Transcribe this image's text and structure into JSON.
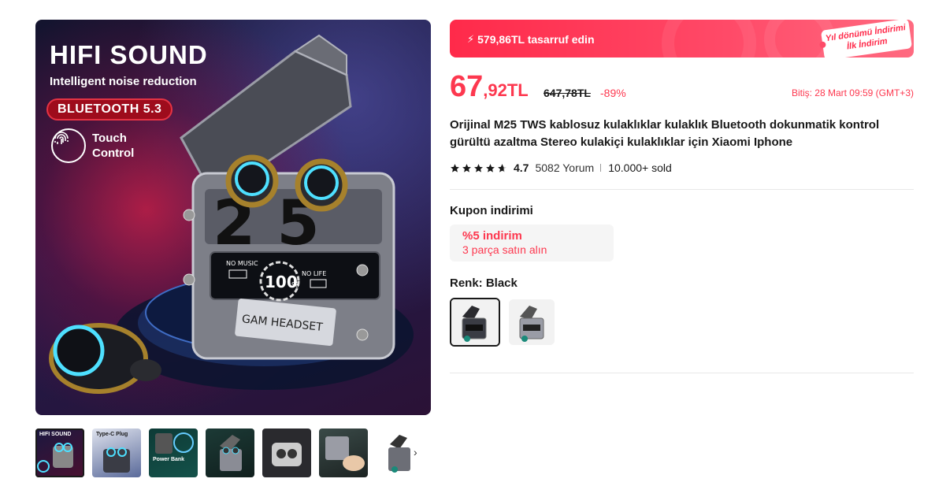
{
  "gallery": {
    "hero": {
      "title": "HIFI SOUND",
      "subtitle": "Intelligent noise reduction",
      "badge": "BLUETOOTH 5.3",
      "touch_label": "Touch\nControl",
      "case_digits": "25",
      "screen_percent": "100",
      "screen_left": "NO MUSIC",
      "screen_right": "NO LIFE",
      "case_label": "GAM HEADSET"
    },
    "thumbnails": [
      {
        "name": "hero",
        "caption": "HIFI SOUND"
      },
      {
        "name": "features",
        "caption": "Type-C Plug"
      },
      {
        "name": "power-bank",
        "caption": "Power Bank"
      },
      {
        "name": "case-open",
        "caption": ""
      },
      {
        "name": "open-case",
        "caption": ""
      },
      {
        "name": "in-hand",
        "caption": ""
      },
      {
        "name": "plain",
        "caption": ""
      }
    ]
  },
  "promo": {
    "savings_text": "579,86TL tasarruf edin",
    "tag_line1": "Yıl dönümü İndirimi",
    "tag_line2": "İlk İndirim"
  },
  "price": {
    "integer": "67",
    "decimal": ",92TL",
    "original": "647,78TL",
    "discount": "-89%",
    "end_text": "Bitiş: 28 Mart 09:59 (GMT+3)"
  },
  "product": {
    "title": "Orijinal M25 TWS kablosuz kulaklıklar kulaklık Bluetooth dokunmatik kontrol gürültü azaltma Stereo kulakiçi kulaklıklar için Xiaomi Iphone"
  },
  "rating": {
    "value": "4.7",
    "stars": 4.7,
    "reviews": "5082 Yorum",
    "sold": "10.000+ sold"
  },
  "coupon": {
    "title": "Kupon indirimi",
    "discount": "%5 indirim",
    "condition": "3 parça satın alın"
  },
  "color": {
    "title": "Renk: Black",
    "options": [
      "Black",
      "Silver"
    ],
    "selected": "Black"
  },
  "colors": {
    "accent": "#fd384f",
    "banner": "#ff2a4a",
    "text": "#191919"
  }
}
